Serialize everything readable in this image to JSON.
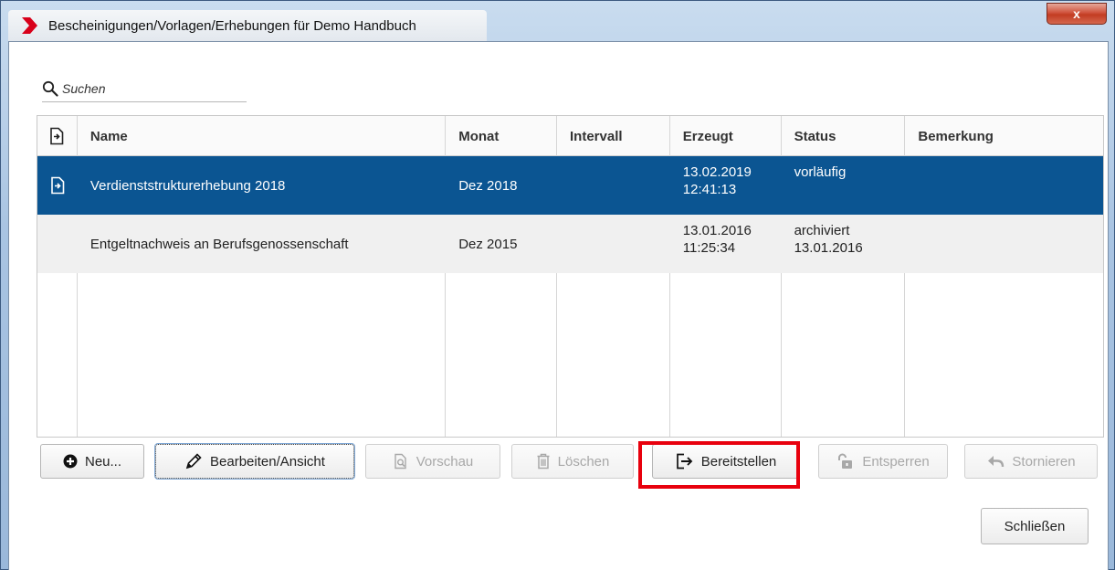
{
  "window": {
    "title": "Bescheinigungen/Vorlagen/Erhebungen für Demo Handbuch",
    "close_label": "x"
  },
  "search": {
    "placeholder": "Suchen"
  },
  "table": {
    "columns": [
      "Name",
      "Monat",
      "Intervall",
      "Erzeugt",
      "Status",
      "Bemerkung"
    ],
    "rows": [
      {
        "name": "Verdienststrukturerhebung 2018",
        "monat": "Dez 2018",
        "intervall": "",
        "erzeugt_date": "13.02.2019",
        "erzeugt_time": "12:41:13",
        "status_line1": "vorläufig",
        "status_line2": "",
        "bemerkung": "",
        "selected": true
      },
      {
        "name": "Entgeltnachweis an Berufsgenossenschaft",
        "monat": "Dez 2015",
        "intervall": "",
        "erzeugt_date": "13.01.2016",
        "erzeugt_time": "11:25:34",
        "status_line1": "archiviert",
        "status_line2": "13.01.2016",
        "bemerkung": "",
        "selected": false
      }
    ]
  },
  "buttons": {
    "neu": "Neu...",
    "bearbeiten": "Bearbeiten/Ansicht",
    "vorschau": "Vorschau",
    "loeschen": "Löschen",
    "bereitstellen": "Bereitstellen",
    "entsperren": "Entsperren",
    "stornieren": "Stornieren",
    "schliessen": "Schließen"
  },
  "colors": {
    "selection": "#0b5592",
    "highlight": "#e8000d"
  },
  "icons": [
    "app-logo-icon",
    "close-icon",
    "search-icon",
    "document-export-icon",
    "plus-circle-icon",
    "pencil-icon",
    "preview-icon",
    "trash-icon",
    "export-arrow-icon",
    "unlock-icon",
    "undo-arrow-icon"
  ]
}
